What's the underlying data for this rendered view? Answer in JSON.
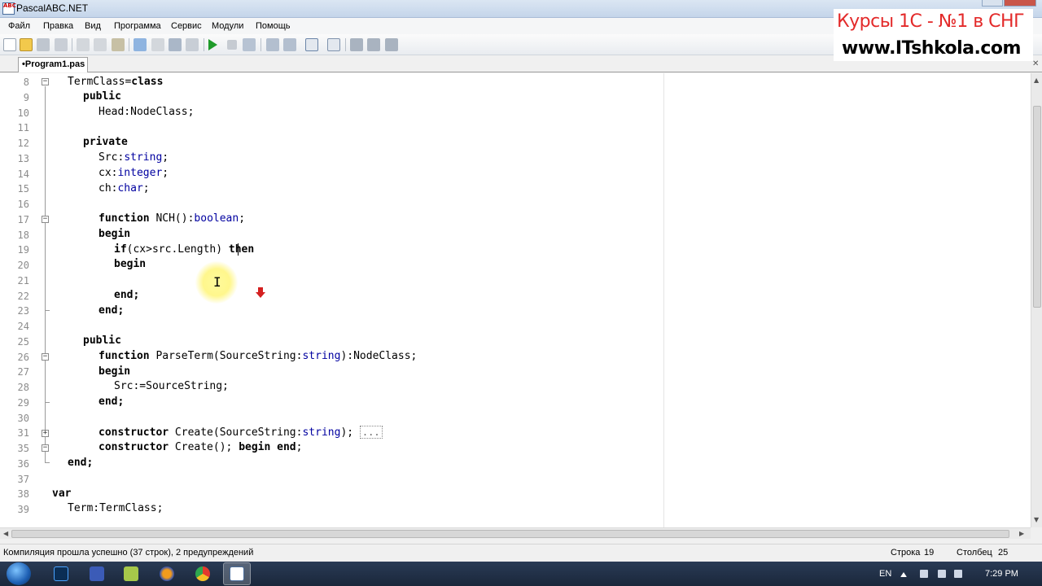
{
  "window": {
    "title": "PascalABC.NET",
    "icon": "pascalabc-app-icon"
  },
  "menu": [
    "Файл",
    "Правка",
    "Вид",
    "Программа",
    "Сервис",
    "Модули",
    "Помощь"
  ],
  "toolbar": {
    "buttons": [
      "new-file-icon",
      "open-file-icon",
      "save-icon",
      "save-all-icon",
      "cut-icon",
      "copy-icon",
      "paste-icon",
      "undo-icon",
      "redo-icon",
      "find-icon",
      "replace-icon",
      "run-icon",
      "stop-icon",
      "compile-icon",
      "step-icon",
      "step-over-icon",
      "output-window-icon",
      "form-designer-icon",
      "debug-icon",
      "watch-icon",
      "locals-icon"
    ]
  },
  "tabs": [
    {
      "label": "•Program1.pas",
      "active": true
    }
  ],
  "banner": {
    "line1": "Курсы 1С - №1 в СНГ",
    "line2": "www.ITshkola.com"
  },
  "editor": {
    "lines": [
      {
        "n": "8",
        "text": "TermClass=class"
      },
      {
        "n": "9",
        "text": "public"
      },
      {
        "n": "10",
        "text": "Head:NodeClass;"
      },
      {
        "n": "11",
        "text": ""
      },
      {
        "n": "12",
        "text": "private"
      },
      {
        "n": "13",
        "text": "Src:string;"
      },
      {
        "n": "14",
        "text": "cx:integer;"
      },
      {
        "n": "15",
        "text": "ch:char;"
      },
      {
        "n": "16",
        "text": ""
      },
      {
        "n": "17",
        "text": "function NCH():boolean;"
      },
      {
        "n": "18",
        "text": "begin"
      },
      {
        "n": "19",
        "text": "if(cx>src.Length) then"
      },
      {
        "n": "20",
        "text": "begin"
      },
      {
        "n": "21",
        "text": ""
      },
      {
        "n": "22",
        "text": "end;"
      },
      {
        "n": "23",
        "text": "end;"
      },
      {
        "n": "24",
        "text": ""
      },
      {
        "n": "25",
        "text": "public"
      },
      {
        "n": "26",
        "text": "function ParseTerm(SourceString:string):NodeClass;"
      },
      {
        "n": "27",
        "text": "begin"
      },
      {
        "n": "28",
        "text": "Src:=SourceString;"
      },
      {
        "n": "29",
        "text": "end;"
      },
      {
        "n": "30",
        "text": ""
      },
      {
        "n": "31",
        "text": "constructor Create(SourceString:string);"
      },
      {
        "n": "35",
        "text": "constructor Create(); begin end;"
      },
      {
        "n": "36",
        "text": "end;"
      },
      {
        "n": "37",
        "text": ""
      },
      {
        "n": "38",
        "text": "var"
      },
      {
        "n": "39",
        "text": "Term:TermClass;"
      }
    ],
    "collapsed_marker": "...",
    "cursor_line": "19"
  },
  "status": {
    "message": "Компиляция прошла успешно (37 строк), 2 предупреждений",
    "row_label": "Строка",
    "row_value": "19",
    "col_label": "Столбец",
    "col_value": "25"
  },
  "taskbar": {
    "language": "EN",
    "time": "7:29 PM",
    "apps": [
      "windows-start-icon",
      "photoshop-icon",
      "save-app-icon",
      "notepad-icon",
      "firefox-icon",
      "chrome-icon",
      "pascalabc-taskbar-icon"
    ]
  },
  "colors": {
    "keyword": "#000000",
    "type": "#0000a0",
    "line_number": "#8c8c8c",
    "banner_red": "#e32a2a"
  }
}
